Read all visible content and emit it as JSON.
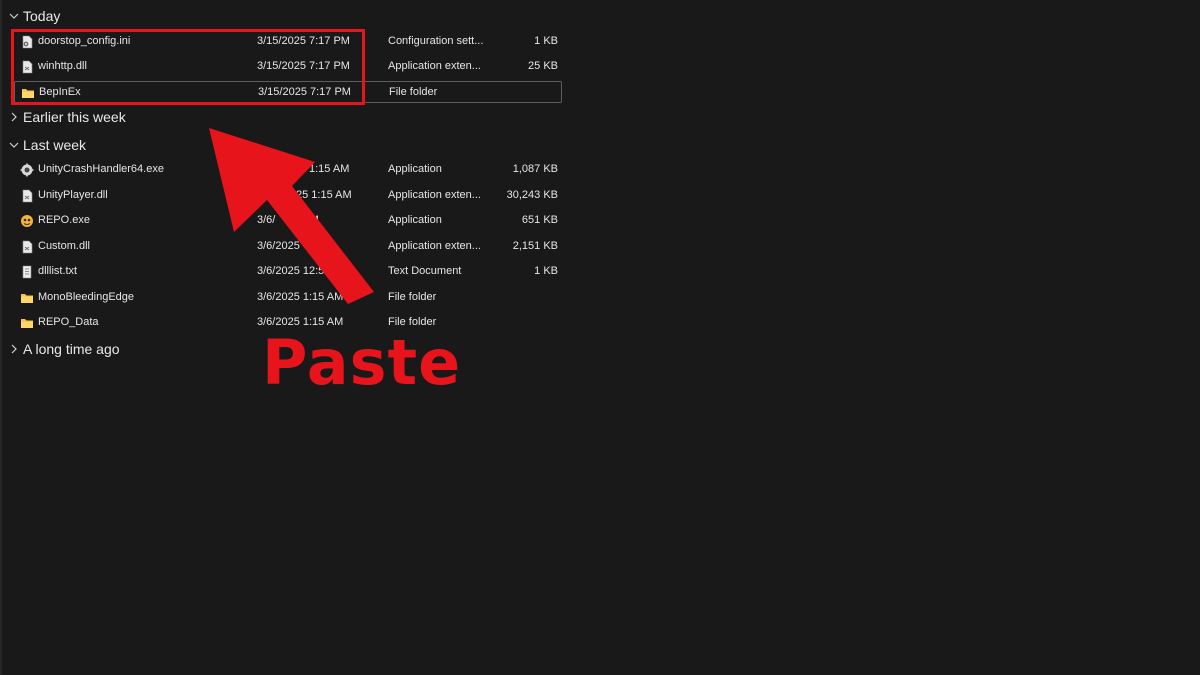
{
  "groups": {
    "today": "Today",
    "earlier_this_week": "Earlier this week",
    "last_week": "Last week",
    "long_ago": "A long time ago"
  },
  "today_files": [
    {
      "name": "doorstop_config.ini",
      "date": "3/15/2025 7:17 PM",
      "type": "Configuration sett...",
      "size": "1 KB",
      "icon": "config-file-icon"
    },
    {
      "name": "winhttp.dll",
      "date": "3/15/2025 7:17 PM",
      "type": "Application exten...",
      "size": "25 KB",
      "icon": "dll-file-icon"
    },
    {
      "name": "BepInEx",
      "date": "3/15/2025 7:17 PM",
      "type": "File folder",
      "size": "",
      "icon": "folder-icon"
    }
  ],
  "last_week_files": [
    {
      "name": "UnityCrashHandler64.exe",
      "date": "1:15 AM",
      "type": "Application",
      "size": "1,087 KB",
      "icon": "exe-gear-icon"
    },
    {
      "name": "UnityPlayer.dll",
      "date": "25 1:15 AM",
      "type": "Application exten...",
      "size": "30,243 KB",
      "icon": "dll-file-icon"
    },
    {
      "name": "REPO.exe",
      "date": "3/6/      5 AM",
      "type": "Application",
      "size": "651 KB",
      "icon": "repo-app-icon"
    },
    {
      "name": "Custom.dll",
      "date": "3/6/2025      M",
      "type": "Application exten...",
      "size": "2,151 KB",
      "icon": "dll-file-icon"
    },
    {
      "name": "dlllist.txt",
      "date": "3/6/2025 12:5",
      "type": "Text Document",
      "size": "1 KB",
      "icon": "text-file-icon"
    },
    {
      "name": "MonoBleedingEdge",
      "date": "3/6/2025 1:15 AM",
      "type": "File folder",
      "size": "",
      "icon": "folder-icon"
    },
    {
      "name": "REPO_Data",
      "date": "3/6/2025 1:15 AM",
      "type": "File folder",
      "size": "",
      "icon": "folder-icon"
    }
  ],
  "annotation": {
    "label": "Paste",
    "color": "#e8141b"
  },
  "colors": {
    "background": "#191919",
    "folder": "#f2c14e",
    "text": "#e6e6e6"
  }
}
